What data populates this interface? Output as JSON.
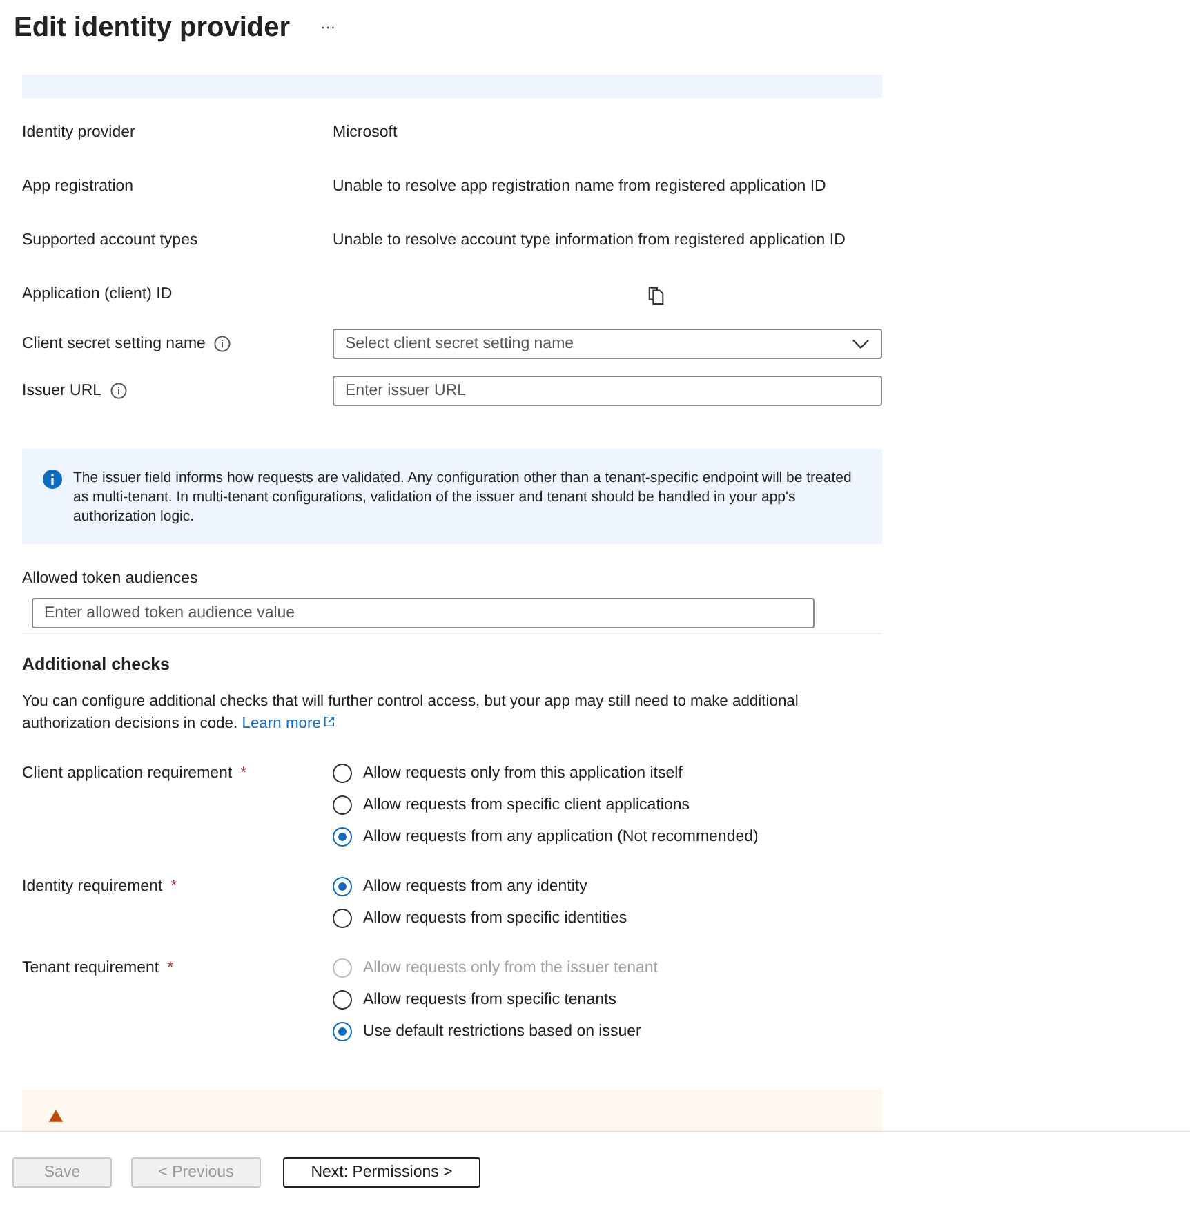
{
  "title": "Edit identity provider",
  "more": "···",
  "fields": [
    {
      "kind": "text",
      "label": "Identity provider",
      "value": "Microsoft"
    },
    {
      "kind": "text",
      "label": "App registration",
      "value": "Unable to resolve app registration name from registered application ID"
    },
    {
      "kind": "text",
      "label": "Supported account types",
      "value": "Unable to resolve account type information from registered application ID"
    },
    {
      "kind": "copy",
      "label": "Application (client) ID"
    },
    {
      "kind": "dropdown",
      "label": "Client secret setting name",
      "info": true,
      "placeholder": "Select client secret setting name"
    },
    {
      "kind": "input",
      "label": "Issuer URL",
      "info": true,
      "placeholder": "Enter issuer URL"
    }
  ],
  "info_message": "The issuer field informs how requests are validated. Any configuration other than a tenant-specific endpoint will be treated as multi-tenant. In multi-tenant configurations, validation of the issuer and tenant should be handled in your app's authorization logic.",
  "audiences": {
    "label": "Allowed token audiences",
    "placeholder": "Enter allowed token audience value"
  },
  "additional_checks": {
    "heading": "Additional checks",
    "text": "You can configure additional checks that will further control access, but your app may still need to make additional authorization decisions in code.",
    "link": "Learn more"
  },
  "requirements": [
    {
      "label": "Client application requirement",
      "required_mark": "*",
      "options": [
        {
          "label": "Allow requests only from this application itself",
          "selected": false,
          "disabled": false
        },
        {
          "label": "Allow requests from specific client applications",
          "selected": false,
          "disabled": false
        },
        {
          "label": "Allow requests from any application (Not recommended)",
          "selected": true,
          "disabled": false
        }
      ]
    },
    {
      "label": "Identity requirement",
      "required_mark": "*",
      "options": [
        {
          "label": "Allow requests from any identity",
          "selected": true,
          "disabled": false
        },
        {
          "label": "Allow requests from specific identities",
          "selected": false,
          "disabled": false
        }
      ]
    },
    {
      "label": "Tenant requirement",
      "required_mark": "*",
      "options": [
        {
          "label": "Allow requests only from the issuer tenant",
          "selected": false,
          "disabled": true
        },
        {
          "label": "Allow requests from specific tenants",
          "selected": false,
          "disabled": false
        },
        {
          "label": "Use default restrictions based on issuer",
          "selected": true,
          "disabled": false
        }
      ]
    }
  ],
  "buttons": [
    {
      "label": "Save",
      "disabled": true
    },
    {
      "label": "< Previous",
      "disabled": true
    },
    {
      "label": "Next: Permissions >",
      "disabled": false
    }
  ]
}
